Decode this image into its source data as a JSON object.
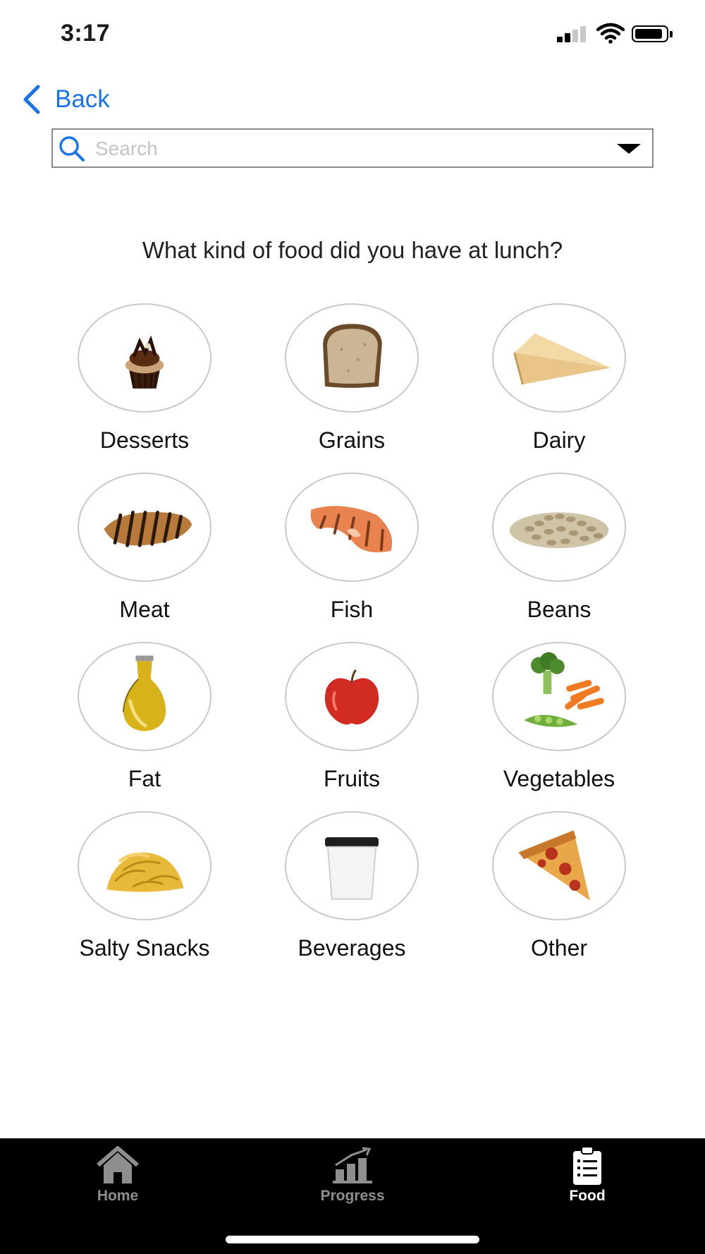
{
  "status_bar": {
    "time": "3:17"
  },
  "nav": {
    "back_label": "Back"
  },
  "search": {
    "placeholder": "Search",
    "value": ""
  },
  "question": "What kind of food did you have at lunch?",
  "categories": [
    {
      "label": "Desserts",
      "icon": "cupcake-icon"
    },
    {
      "label": "Grains",
      "icon": "bread-icon"
    },
    {
      "label": "Dairy",
      "icon": "cheese-icon"
    },
    {
      "label": "Meat",
      "icon": "grilled-chicken-icon"
    },
    {
      "label": "Fish",
      "icon": "salmon-steak-icon"
    },
    {
      "label": "Beans",
      "icon": "beans-icon"
    },
    {
      "label": "Fat",
      "icon": "oil-bottle-icon"
    },
    {
      "label": "Fruits",
      "icon": "apple-icon"
    },
    {
      "label": "Vegetables",
      "icon": "vegetables-icon"
    },
    {
      "label": "Salty Snacks",
      "icon": "chips-icon"
    },
    {
      "label": "Beverages",
      "icon": "coffee-cup-icon"
    },
    {
      "label": "Other",
      "icon": "pizza-slice-icon"
    }
  ],
  "tabs": [
    {
      "label": "Home",
      "icon": "house-icon",
      "active": false
    },
    {
      "label": "Progress",
      "icon": "chart-icon",
      "active": false
    },
    {
      "label": "Food",
      "icon": "clipboard-icon",
      "active": true
    }
  ],
  "colors": {
    "accent": "#1a73e8",
    "tab_inactive": "#8e8e8e",
    "tab_active": "#ffffff",
    "tab_bar": "#000000"
  }
}
